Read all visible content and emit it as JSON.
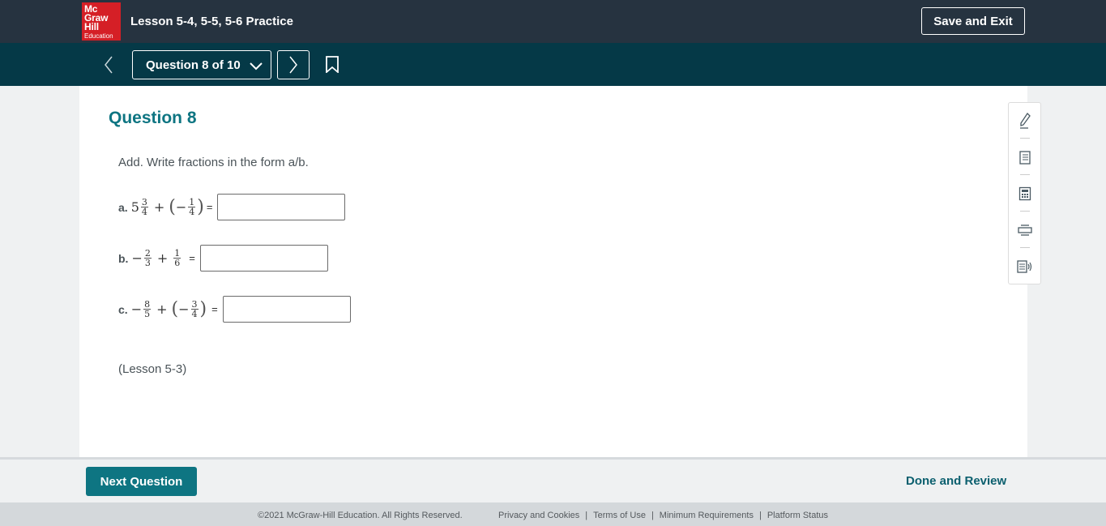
{
  "brand": {
    "line1": "Mc",
    "line2": "Graw",
    "line3": "Hill",
    "line4": "Education",
    "color": "#d51f26"
  },
  "header": {
    "title": "Lesson 5-4, 5-5, 5-6 Practice",
    "save_exit_label": "Save and Exit"
  },
  "nav": {
    "question_selector": "Question 8 of 10",
    "prev_icon": "chevron-left-icon",
    "next_icon": "chevron-right-icon",
    "bookmark_icon": "bookmark-icon"
  },
  "question": {
    "title": "Question 8",
    "instruction": "Add. Write fractions in the form a/b.",
    "parts": [
      {
        "label": "a.",
        "whole": "5",
        "f1_num": "3",
        "f1_den": "4",
        "op": "+",
        "neg": "−",
        "f2_num": "1",
        "f2_den": "4",
        "eq": "=",
        "answer": ""
      },
      {
        "label": "b.",
        "neg": "−",
        "f1_num": "2",
        "f1_den": "3",
        "op": "+",
        "f2_num": "1",
        "f2_den": "6",
        "eq": "=",
        "answer": ""
      },
      {
        "label": "c.",
        "neg": "−",
        "f1_num": "8",
        "f1_den": "5",
        "op": "+",
        "f2_num": "3",
        "f2_den": "4",
        "eq": "=",
        "answer": ""
      }
    ],
    "lesson_ref": "(Lesson 5-3)"
  },
  "tools": [
    "pencil-icon",
    "notes-icon",
    "calculator-icon",
    "print-icon",
    "read-aloud-icon"
  ],
  "footer": {
    "next_label": "Next Question",
    "done_label": "Done and Review",
    "copyright": "©2021 McGraw-Hill Education. All Rights Reserved.",
    "links": [
      "Privacy and Cookies",
      "Terms of Use",
      "Minimum Requirements",
      "Platform Status"
    ]
  },
  "colors": {
    "topbar": "#263340",
    "navbar": "#053947",
    "accent": "#0e7582"
  }
}
